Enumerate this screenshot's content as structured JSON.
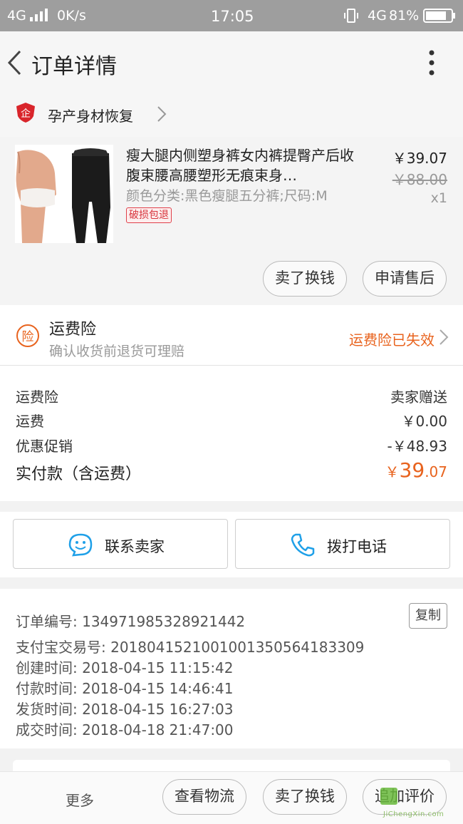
{
  "status_bar": {
    "network_left": "4G",
    "speed": "0K/s",
    "time": "17:05",
    "network_right": "4G",
    "battery": "81%"
  },
  "header": {
    "title": "订单详情",
    "back_icon": "chevron-left-icon",
    "more_icon": "vertical-dots-icon"
  },
  "store": {
    "name": "孕产身材恢复",
    "badge_char": "企",
    "badge_color": "#d9252b"
  },
  "product": {
    "title": "瘦大腿内侧塑身裤女内裤提臀产后收腹束腰高腰塑形无痕束身…",
    "sku": "颜色分类:黑色瘦腿五分裤;尺码:M",
    "tag": "破损包退",
    "price": "￥39.07",
    "original_price": "￥88.00",
    "quantity": "x1",
    "sell_button": "卖了换钱",
    "aftersale_button": "申请售后"
  },
  "insurance": {
    "icon_char": "险",
    "title": "运费险",
    "subtitle": "确认收货前退货可理赔",
    "status": "运费险已失效",
    "accent_color": "#e8631e"
  },
  "price_summary": {
    "rows": [
      {
        "label": "运费险",
        "value": "卖家赠送"
      },
      {
        "label": "运费",
        "value": "￥0.00"
      },
      {
        "label": "优惠促销",
        "value": "-￥48.93"
      }
    ],
    "total_label": "实付款（含运费）",
    "total_currency": "￥",
    "total_int": "39",
    "total_dec": ".07"
  },
  "contact": {
    "seller_label": "联系卖家",
    "call_label": "拨打电话"
  },
  "order_info": {
    "order_no_label": "订单编号: ",
    "order_no": "134971985328921442",
    "copy_label": "复制",
    "rows": [
      "支付宝交易号: 2018041521001001350564183309",
      "创建时间: 2018-04-15 11:15:42",
      "付款时间: 2018-04-15 14:46:41",
      "发货时间: 2018-04-15 16:27:03",
      "成交时间: 2018-04-18 21:47:00"
    ]
  },
  "bottom_bar": {
    "more": "更多",
    "logistics": "查看物流",
    "sell": "卖了换钱",
    "review": "追加评价",
    "watermark": "JiChengXin.com"
  }
}
